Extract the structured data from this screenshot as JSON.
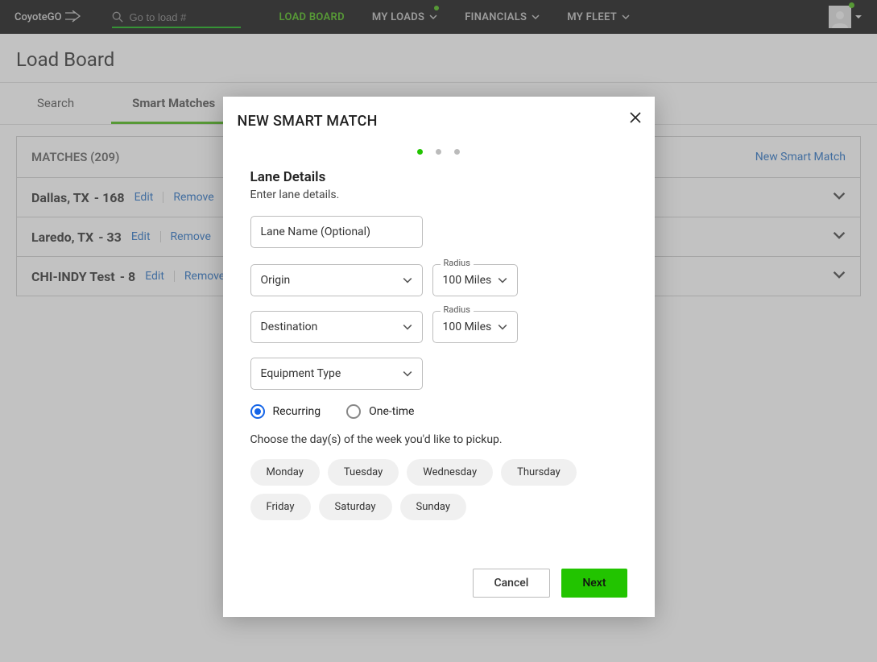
{
  "brand": "CoyoteGO",
  "search_placeholder": "Go to load #",
  "nav": {
    "load_board": "LOAD BOARD",
    "my_loads": "MY LOADS",
    "financials": "FINANCIALS",
    "my_fleet": "MY FLEET"
  },
  "page_title": "Load Board",
  "tabs": {
    "search": "Search",
    "smart_matches": "Smart Matches"
  },
  "matches": {
    "header_label": "MATCHES",
    "header_count": "(209)",
    "new_link": "New Smart Match",
    "rows": [
      {
        "title": "Dallas, TX",
        "count": "- 168"
      },
      {
        "title": "Laredo, TX",
        "count": "- 33"
      },
      {
        "title": "CHI-INDY Test",
        "count": "- 8"
      }
    ],
    "edit_label": "Edit",
    "remove_label": "Remove"
  },
  "modal": {
    "title": "NEW SMART MATCH",
    "section_title": "Lane Details",
    "section_sub": "Enter lane details.",
    "lane_name_ph": "Lane Name (Optional)",
    "origin_ph": "Origin",
    "destination_ph": "Destination",
    "radius_label": "Radius",
    "radius_value": "100 Miles",
    "equipment_ph": "Equipment Type",
    "recurring": "Recurring",
    "one_time": "One-time",
    "hint": "Choose the day(s) of the week you'd like to pickup.",
    "days": [
      "Monday",
      "Tuesday",
      "Wednesday",
      "Thursday",
      "Friday",
      "Saturday",
      "Sunday"
    ],
    "cancel": "Cancel",
    "next": "Next"
  }
}
